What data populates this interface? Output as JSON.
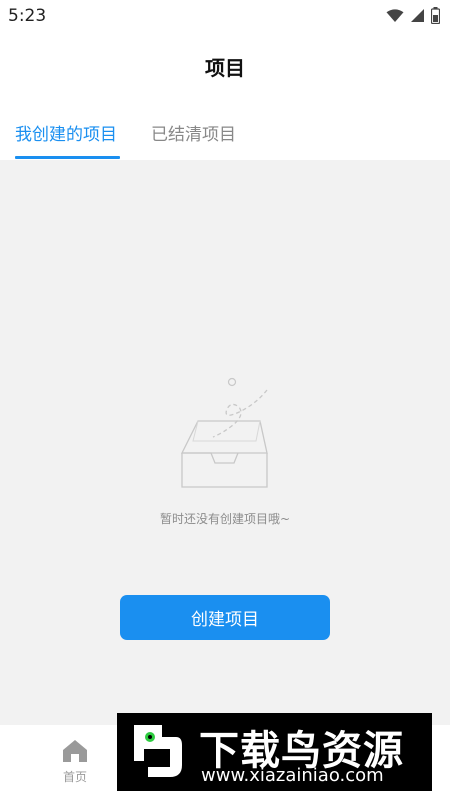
{
  "status_bar": {
    "time": "5:23",
    "icons": [
      "wifi-icon",
      "signal-icon",
      "battery-icon"
    ]
  },
  "header": {
    "title": "项目"
  },
  "tabs": [
    {
      "label": "我创建的项目",
      "active": true
    },
    {
      "label": "已结清项目",
      "active": false
    }
  ],
  "empty_state": {
    "icon": "empty-box-icon",
    "message": "暂时还没有创建项目哦~"
  },
  "actions": {
    "create_label": "创建项目"
  },
  "bottom_nav": {
    "items": [
      {
        "label": "首页",
        "icon": "home-icon"
      }
    ]
  },
  "watermark": {
    "title": "下载鸟资源",
    "url": "www.xiazainiao.com"
  },
  "colors": {
    "accent": "#1a8ff0",
    "background": "#f2f2f2",
    "inactive_text": "#888888"
  }
}
